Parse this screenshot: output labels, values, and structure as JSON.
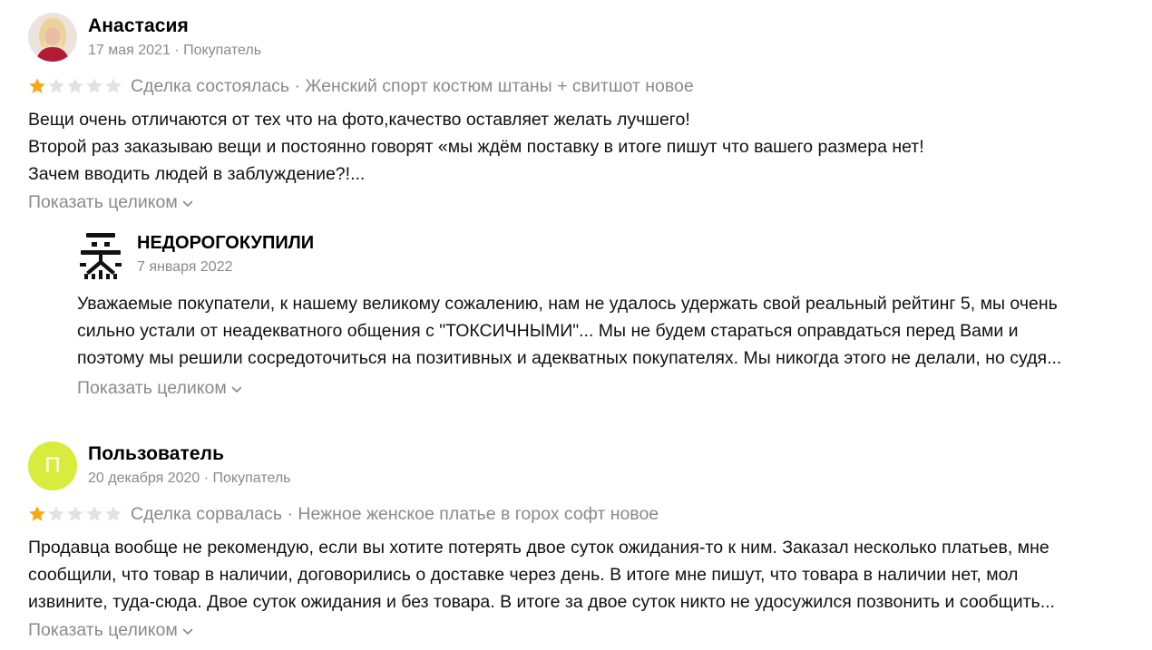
{
  "reviews": [
    {
      "author": "Анастасия",
      "date": "17 мая 2021",
      "role": "Покупатель",
      "meta": "17 мая 2021 · Покупатель",
      "rating": 1,
      "rating_max": 5,
      "deal_info": "Сделка состоялась · Женский спорт костюм штаны + свитшот новое",
      "text_lines": [
        "Вещи очень отличаются от тех что на фото,качество оставляет желать лучшего!",
        "Второй раз заказываю вещи и постоянно говорят «мы ждём поставку в итоге пишут что вашего размера нет!",
        "Зачем вводить людей в заблуждение?!..."
      ],
      "show_more": "Показать целиком",
      "reply": {
        "author": "НЕДОРОГОКУПИЛИ",
        "date": "7 января 2022",
        "text_lines": [
          "Уважаемые покупатели, к нашему великому сожалению, нам не удалось удержать свой реальный рейтинг 5, мы очень",
          "сильно устали от неадекватного общения с \"ТОКСИЧНЫМИ\"... Мы не будем стараться оправдаться перед Вами и",
          "поэтому мы решили сосредоточиться на позитивных и адекватных покупателях. Мы никогда этого не делали, но судя..."
        ],
        "show_more": "Показать целиком"
      }
    },
    {
      "author": "Пользователь",
      "avatar_letter": "П",
      "date": "20 декабря 2020",
      "role": "Покупатель",
      "meta": "20 декабря 2020 · Покупатель",
      "rating": 1,
      "rating_max": 5,
      "deal_info": "Сделка сорвалась · Нежное женское платье в горох софт новое",
      "text_lines": [
        "Продавца вообще не рекомендую, если вы хотите потерять двое суток ожидания-то к ним. Заказал несколько платьев, мне",
        "сообщили, что товар в наличии, договорились о доставке через день. В итоге мне пишут, что товара в наличии нет, мол",
        "извините, туда-сюда. Двое суток ожидания и без товара. В итоге за двое суток никто не удосужился позвонить и сообщить..."
      ],
      "show_more": "Показать целиком"
    }
  ],
  "colors": {
    "star_filled": "#f7a813",
    "star_empty": "#e2e2e2",
    "muted_text": "#8a8a8a",
    "avatar_letter_bg": "#d7ec3c"
  },
  "icons": {
    "chevron": "chevron-down-icon",
    "star": "star-icon",
    "seller_logo": "seller-logo-icon"
  }
}
